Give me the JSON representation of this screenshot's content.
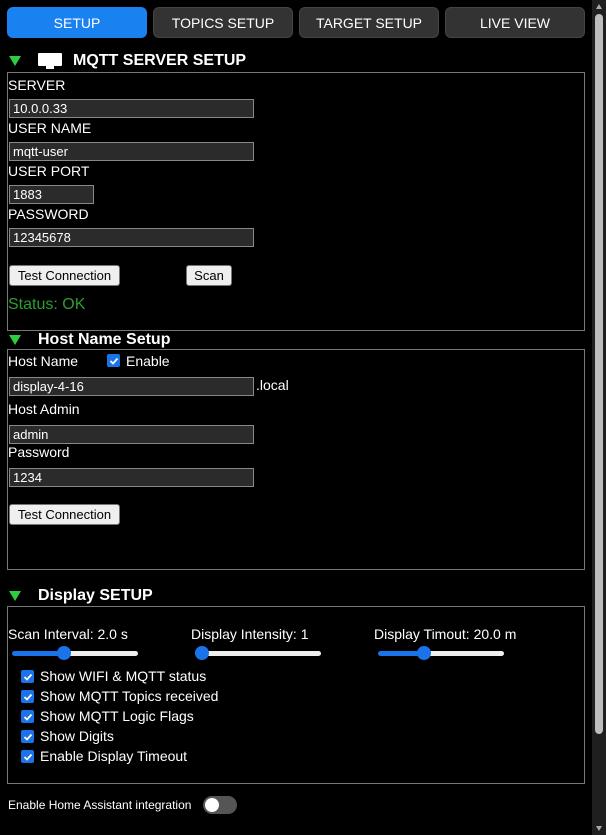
{
  "tabs": [
    {
      "label": "SETUP",
      "active": true
    },
    {
      "label": "TOPICS SETUP",
      "active": false
    },
    {
      "label": "TARGET SETUP",
      "active": false
    },
    {
      "label": "LIVE VIEW",
      "active": false
    }
  ],
  "mqtt": {
    "title": "MQTT SERVER SETUP",
    "server_label": "SERVER",
    "server_value": "10.0.0.33",
    "user_label": "USER NAME",
    "user_value": "mqtt-user",
    "port_label": "USER PORT",
    "port_value": "1883",
    "password_label": "PASSWORD",
    "password_value": "12345678",
    "test_button": "Test Connection",
    "scan_button": "Scan",
    "status": "Status: OK"
  },
  "host": {
    "title": "Host Name Setup",
    "hostname_label": "Host Name",
    "enable_label": "Enable",
    "enable_checked": true,
    "hostname_value": "display-4-16",
    "suffix": ".local",
    "admin_label": "Host Admin",
    "admin_value": "admin",
    "password_label": "Password",
    "password_value": "1234",
    "test_button": "Test Connection"
  },
  "display": {
    "title": "Display SETUP",
    "scan_interval_label": "Scan Interval: 2.0 s",
    "intensity_label": "Display Intensity: 1",
    "timeout_label": "Display Timout: 20.0 m",
    "scan_interval_fraction": 0.4,
    "intensity_fraction": 0.0,
    "timeout_fraction": 0.35,
    "options": [
      {
        "label": "Show WIFI & MQTT status",
        "checked": true
      },
      {
        "label": "Show MQTT Topics received",
        "checked": true
      },
      {
        "label": "Show MQTT Logic Flags",
        "checked": true
      },
      {
        "label": "Show Digits",
        "checked": true
      },
      {
        "label": "Enable Display Timeout",
        "checked": true
      }
    ]
  },
  "home_assistant": {
    "label": "Enable Home Assistant integration",
    "enabled": false
  },
  "colors": {
    "accent": "#1a82f0",
    "status_ok": "#2e9e2e",
    "section_arrow": "#2ecc40"
  }
}
